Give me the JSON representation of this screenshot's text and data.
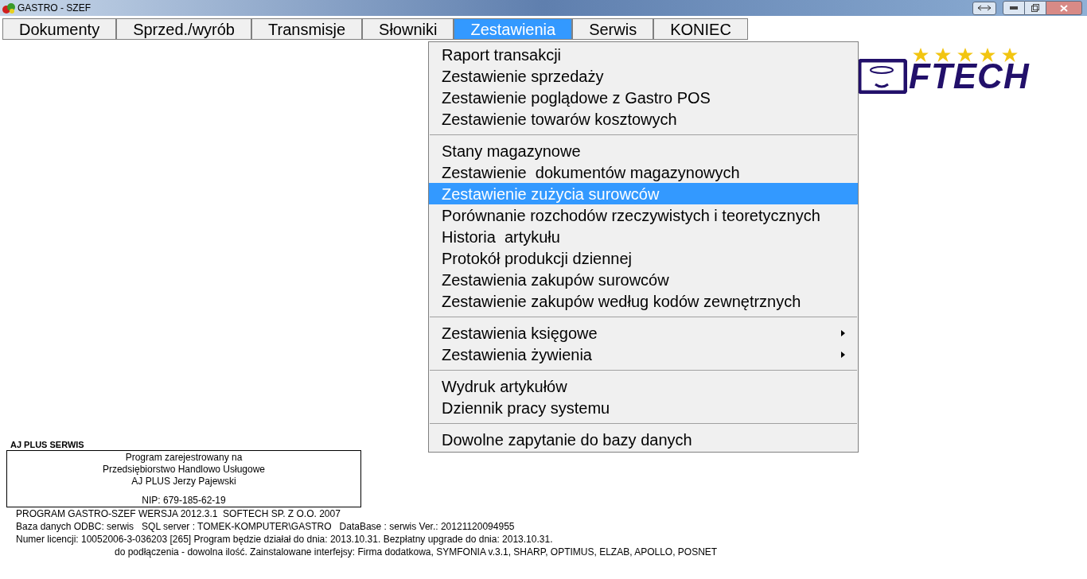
{
  "window": {
    "title": "GASTRO - SZEF"
  },
  "menubar": [
    {
      "label": "Dokumenty",
      "selected": false
    },
    {
      "label": "Sprzed./wyrób",
      "selected": false
    },
    {
      "label": "Transmisje",
      "selected": false
    },
    {
      "label": "Słowniki",
      "selected": false
    },
    {
      "label": "Zestawienia",
      "selected": true
    },
    {
      "label": "Serwis",
      "selected": false
    },
    {
      "label": "KONIEC",
      "selected": false
    }
  ],
  "dropdown": [
    {
      "kind": "item",
      "label": "Raport transakcji",
      "selected": false,
      "submenu": false
    },
    {
      "kind": "item",
      "label": "Zestawienie sprzedaży",
      "selected": false,
      "submenu": false
    },
    {
      "kind": "item",
      "label": "Zestawienie poglądowe z Gastro POS",
      "selected": false,
      "submenu": false
    },
    {
      "kind": "item",
      "label": "Zestawienie towarów kosztowych",
      "selected": false,
      "submenu": false
    },
    {
      "kind": "separator"
    },
    {
      "kind": "item",
      "label": "Stany magazynowe",
      "selected": false,
      "submenu": false
    },
    {
      "kind": "item",
      "label": "Zestawienie  dokumentów magazynowych",
      "selected": false,
      "submenu": false
    },
    {
      "kind": "item",
      "label": "Zestawienie zużycia surowców",
      "selected": true,
      "submenu": false
    },
    {
      "kind": "item",
      "label": "Porównanie rozchodów rzeczywistych i teoretycznych",
      "selected": false,
      "submenu": false
    },
    {
      "kind": "item",
      "label": "Historia  artykułu",
      "selected": false,
      "submenu": false
    },
    {
      "kind": "item",
      "label": "Protokół produkcji dziennej",
      "selected": false,
      "submenu": false
    },
    {
      "kind": "item",
      "label": "Zestawienia zakupów surowców",
      "selected": false,
      "submenu": false
    },
    {
      "kind": "item",
      "label": "Zestawienie zakupów według kodów zewnętrznych",
      "selected": false,
      "submenu": false
    },
    {
      "kind": "separator"
    },
    {
      "kind": "item",
      "label": "Zestawienia księgowe",
      "selected": false,
      "submenu": true
    },
    {
      "kind": "item",
      "label": "Zestawienia żywienia",
      "selected": false,
      "submenu": true
    },
    {
      "kind": "separator"
    },
    {
      "kind": "item",
      "label": "Wydruk artykułów",
      "selected": false,
      "submenu": false
    },
    {
      "kind": "item",
      "label": "Dziennik pracy systemu",
      "selected": false,
      "submenu": false
    },
    {
      "kind": "separator"
    },
    {
      "kind": "item",
      "label": "Dowolne zapytanie do bazy danych",
      "selected": false,
      "submenu": false
    }
  ],
  "logo": {
    "text": "FTECH",
    "stars": 5
  },
  "registration": {
    "heading": "AJ PLUS SERWIS",
    "lines": [
      "Program zarejestrowany na",
      "Przedsiębiorstwo Handlowo Usługowe",
      "AJ PLUS Jerzy Pajewski"
    ],
    "nip": "NIP: 679-185-62-19"
  },
  "info_lines": [
    "PROGRAM GASTRO-SZEF WERSJA 2012.3.1  SOFTECH SP. Z O.O. 2007",
    "Baza danych ODBC: serwis   SQL server : TOMEK-KOMPUTER\\GASTRO   DataBase : serwis Ver.: 20121120094955",
    "Numer licencji: 10052006-3-036203 [265] Program będzie działał do dnia: 2013.10.31. Bezpłatny upgrade do dnia: 2013.10.31.",
    "do podłączenia - dowolna ilość. Zainstalowane interfejsy: Firma dodatkowa, SYMFONIA v.3.1, SHARP, OPTIMUS, ELZAB, APOLLO, POSNET"
  ]
}
